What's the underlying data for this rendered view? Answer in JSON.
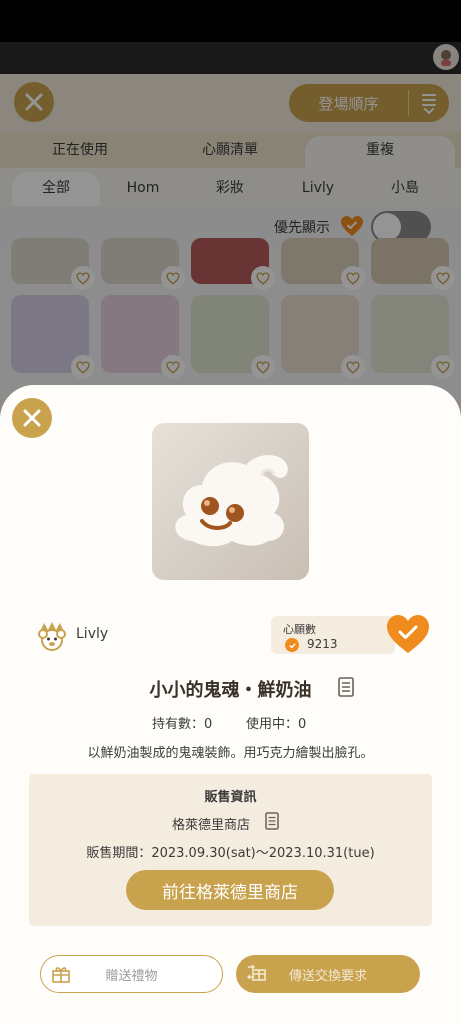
{
  "background": {
    "sort_label": "登場順序",
    "tabs_primary": [
      "正在使用",
      "心願清單",
      "重複"
    ],
    "tabs_secondary": [
      "全部",
      "Hom",
      "彩妝",
      "Livly",
      "小島"
    ],
    "priority_label": "優先顯示"
  },
  "sheet": {
    "brand_label": "Livly",
    "wish_title": "心願數",
    "wish_count": "9213",
    "item_title": "小小的鬼魂・鮮奶油",
    "owned_label": "持有數：0",
    "in_use_label": "使用中：0",
    "description": "以鮮奶油製成的鬼魂裝飾。用巧克力繪製出臉孔。",
    "sale": {
      "title": "販售資訊",
      "shop_name": "格萊德里商店",
      "period": "販售期間：2023.09.30(sat)〜2023.10.31(tue)",
      "goto_button": "前往格萊德里商店"
    },
    "gift_button": "贈送禮物",
    "trade_button": "傳送交換要求"
  },
  "colors": {
    "accent": "#c9a24e",
    "heart": "#f08c1e"
  }
}
